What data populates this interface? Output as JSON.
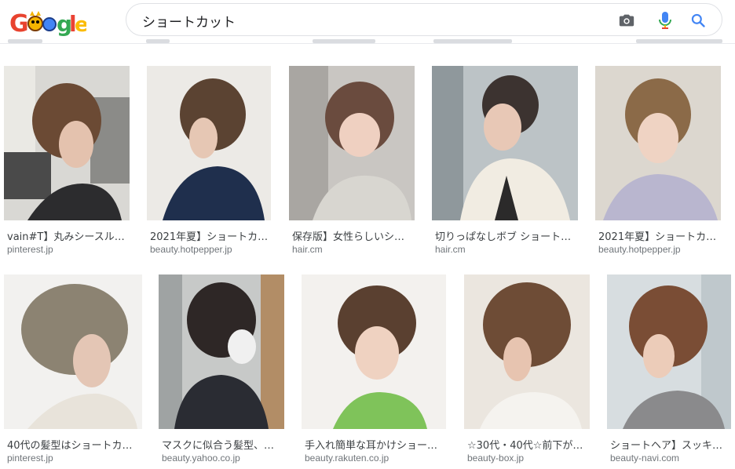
{
  "header": {
    "logo_text": "Google",
    "search_value": "ショートカット"
  },
  "colors": {
    "accent_blue": "#1a73e8",
    "mic_red": "#ea4335",
    "caption": "#3c4043",
    "domain": "#70757a"
  },
  "icons": [
    "camera-icon",
    "microphone-icon",
    "search-icon"
  ],
  "results": [
    {
      "title": "vain#T】丸みシースル…",
      "domain": "pinterest.jp"
    },
    {
      "title": "2021年夏】ショートカ…",
      "domain": "beauty.hotpepper.jp"
    },
    {
      "title": "保存版】女性らしいシ…",
      "domain": "hair.cm"
    },
    {
      "title": "切りっぱなしボブ ショート…",
      "domain": "hair.cm"
    },
    {
      "title": "2021年夏】ショートカ…",
      "domain": "beauty.hotpepper.jp"
    },
    {
      "title": "40代の髪型はショートカ…",
      "domain": "pinterest.jp"
    },
    {
      "title": "マスクに似合う髪型、…",
      "domain": "beauty.yahoo.co.jp"
    },
    {
      "title": "手入れ簡単な耳かけショー…",
      "domain": "beauty.rakuten.co.jp"
    },
    {
      "title": "☆30代・40代☆前下が…",
      "domain": "beauty-box.jp"
    },
    {
      "title": "ショートヘア】スッキ…",
      "domain": "beauty-navi.com"
    }
  ]
}
